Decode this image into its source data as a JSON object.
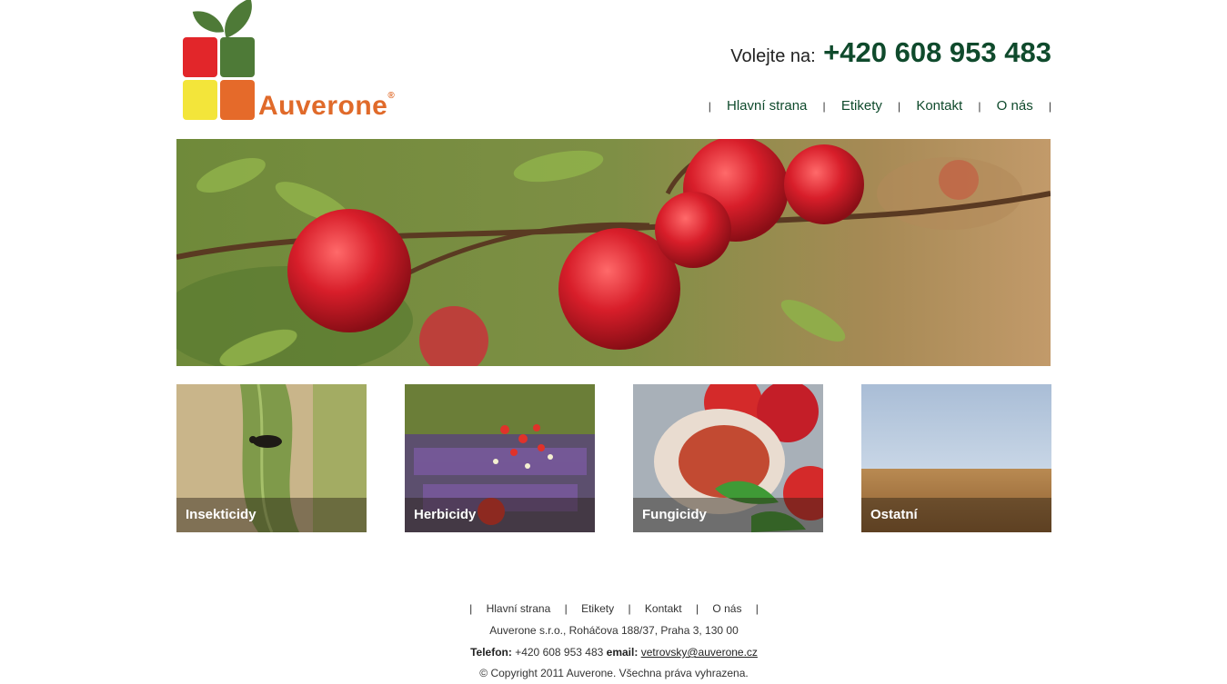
{
  "brand": {
    "name": "Auverone",
    "reg": "®"
  },
  "phone": {
    "label": "Volejte na:",
    "number": "+420 608 953 483"
  },
  "nav": {
    "sep": "|",
    "items": [
      {
        "label": "Hlavní strana"
      },
      {
        "label": "Etikety"
      },
      {
        "label": "Kontakt"
      },
      {
        "label": "O nás"
      }
    ]
  },
  "categories": [
    {
      "label": "Insekticidy"
    },
    {
      "label": "Herbicidy"
    },
    {
      "label": "Fungicidy"
    },
    {
      "label": "Ostatní"
    }
  ],
  "footer": {
    "nav": [
      "Hlavní strana",
      "Etikety",
      "Kontakt",
      "O nás"
    ],
    "address": "Auverone s.r.o., Roháčova 188/37, Praha 3, 130 00",
    "phone_label": "Telefon:",
    "phone": "+420 608 953 483",
    "email_label": "email:",
    "email": "vetrovsky@auverone.cz",
    "copyright": "© Copyright 2011 Auverone. Všechna práva vyhrazena."
  },
  "colors": {
    "accent_green": "#0f4a2c",
    "logo_orange": "#e06a2a",
    "logo_red": "#e2262a",
    "logo_green": "#4e7a37",
    "logo_yellow": "#f3e53a"
  }
}
